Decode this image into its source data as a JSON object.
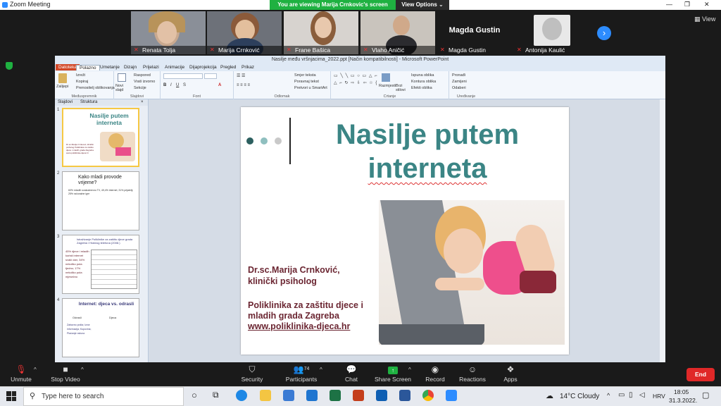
{
  "zoom": {
    "window_title": "Zoom Meeting",
    "share_banner": "You are viewing Marija Crnkovic's screen",
    "view_options": "View Options",
    "view_label": "View",
    "participants": [
      {
        "name": "Renata Tolja"
      },
      {
        "name": "Marija Crnković"
      },
      {
        "name": "Frane Bašica"
      },
      {
        "name": "Vlaho Aničić"
      },
      {
        "name": "Magda Gustin",
        "big_name": "Magda Gustin"
      },
      {
        "name": "Antonija Kaulić"
      }
    ],
    "toolbar": {
      "unmute": "Unmute",
      "stop_video": "Stop Video",
      "security": "Security",
      "participants": "Participants",
      "participants_count": "74",
      "chat": "Chat",
      "share_screen": "Share Screen",
      "record": "Record",
      "reactions": "Reactions",
      "apps": "Apps",
      "end": "End"
    }
  },
  "ppt": {
    "title": "Nasilje među vršnjacima_2022.ppt [Način kompatibilnosti] - Microsoft PowerPoint",
    "tabs": [
      "Datoteka",
      "Polazno",
      "Umetanje",
      "Dizajn",
      "Prijelazi",
      "Animacije",
      "Dijaprojekcija",
      "Pregled",
      "Prikaz"
    ],
    "ribbon": {
      "clipboard": {
        "paste": "Zalijepi",
        "cut": "Izreži",
        "copy": "Kopiraj",
        "format": "Prenositelj oblikovanja",
        "label": "Međuspremnik"
      },
      "slides": {
        "new": "Novi slajd",
        "layout": "Raspored",
        "reset": "Vrati izvorno",
        "section": "Sekcije",
        "label": "Slajdovi"
      },
      "font_label": "Font",
      "paragraph_label": "Odlomak",
      "paragraph": {
        "dir": "Smjer teksta",
        "align": "Poravnaj tekst",
        "smart": "Pretvori u SmartArt"
      },
      "drawing": {
        "arrange": "Razmjesti",
        "styles": "Brzi stilovi",
        "fill": "Ispuna oblika",
        "outline": "Kontura oblika",
        "effects": "Efekti oblika",
        "label": "Crtanje"
      },
      "editing": {
        "find": "Pronađi",
        "replace": "Zamijeni",
        "select": "Odaberi",
        "label": "Uređivanje"
      }
    },
    "pane_tabs": [
      "Slajdovi",
      "Struktura"
    ],
    "thumbs": [
      {
        "num": "1",
        "title": "Nasilje putem interneta",
        "body": "Dr.sc.Marija Crnković, klinički psiholog  Poliklinika za zaštitu djece i mladih grada Zagreba www.poliklinika-djeca.hr"
      },
      {
        "num": "2",
        "title": "Kako mladi provode vrijeme?",
        "body": "60% mladih svakodnevno TV, 49,4% internet, 31% prijatelji, 25% računalne igre"
      },
      {
        "num": "3",
        "title": "Istraživanje Poliklinike za zaštitu djece grada Zagreba i Hrabrog telefona (2008.)",
        "body": "45% djece i mladih koristi internet svaki dan; 34% nekoliko puta tjedno; 17% nekoliko puta mjesečno"
      },
      {
        "num": "4",
        "title": "Internet: djeca vs. odrasli",
        "left": "Odrasli",
        "right": "Djeca",
        "body": "Zabavno pošta; Izvor informacija; Kupovina; Plaćanje računa"
      }
    ],
    "slide": {
      "title_line1": "Nasilje putem",
      "title_line2": "interneta",
      "author_line1": "Dr.sc.Marija Crnković,",
      "author_line2": "klinički psiholog",
      "org_line1": "Poliklinika za zaštitu djece i",
      "org_line2": "mladih grada Zagreba",
      "url": "www.poliklinika-djeca.hr"
    }
  },
  "windows": {
    "search_placeholder": "Type here to search",
    "weather": "14°C  Cloudy",
    "lang": "HRV",
    "time": "18:05",
    "date": "31.3.2022."
  },
  "colors": {
    "title_teal": "#3b8585",
    "author_maroon": "#6b2632",
    "zoom_green": "#1fb141",
    "zoom_blue": "#2d8cff",
    "end_red": "#e02828"
  }
}
